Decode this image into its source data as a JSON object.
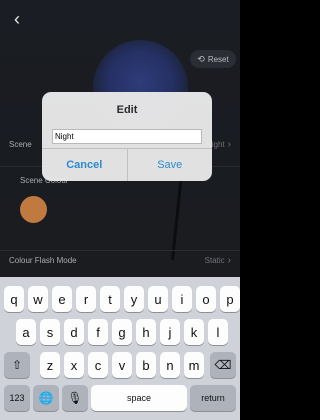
{
  "nav": {
    "back_icon": "chevron-left-icon"
  },
  "reset": {
    "label": "Reset",
    "icon": "refresh-icon"
  },
  "settings": {
    "scene_row": {
      "label": "Scene",
      "value": "Night"
    },
    "scene_colour": {
      "label": "Scene Colour",
      "swatch_color": "#c07a40"
    },
    "colour_flash_mode": {
      "label": "Colour Flash Mode",
      "value": "Static"
    }
  },
  "dialog": {
    "title": "Edit",
    "input_value": "Night",
    "cancel_label": "Cancel",
    "save_label": "Save"
  },
  "keyboard": {
    "row1": [
      "q",
      "w",
      "e",
      "r",
      "t",
      "y",
      "u",
      "i",
      "o",
      "p"
    ],
    "row2": [
      "a",
      "s",
      "d",
      "f",
      "g",
      "h",
      "j",
      "k",
      "l"
    ],
    "row3": [
      "z",
      "x",
      "c",
      "v",
      "b",
      "n",
      "m"
    ],
    "shift_icon": "shift-icon",
    "delete_icon": "delete-icon",
    "numbers_label": "123",
    "globe_icon": "globe-icon",
    "mic_icon": "microphone-icon",
    "space_label": "space",
    "return_label": "return"
  }
}
